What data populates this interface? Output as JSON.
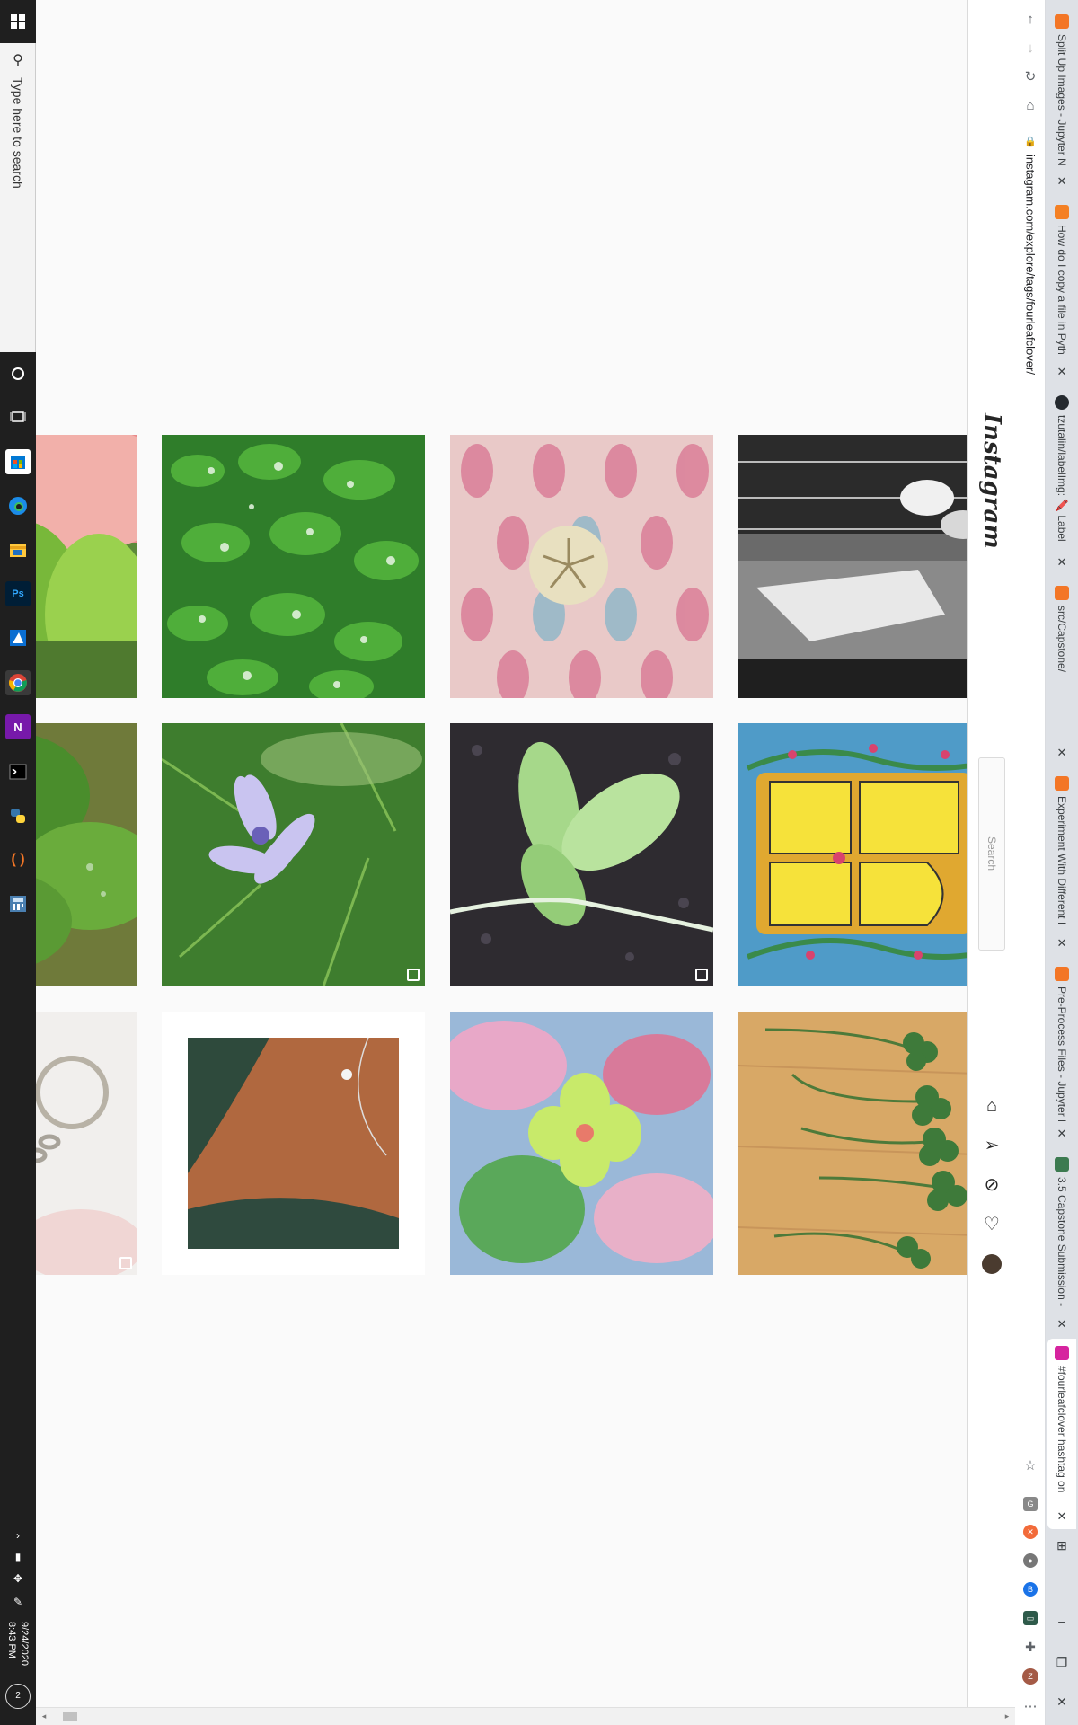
{
  "taskbar": {
    "search_placeholder": "Type here to search",
    "start_icon": "windows-logo-icon",
    "pinned_apps": [
      "cortana-circle-icon",
      "task-view-icon",
      "store-icon",
      "edge-icon",
      "file-explorer-icon",
      "photoshop-icon",
      "azure-data-studio-icon",
      "chrome-icon",
      "onenote-icon",
      "terminal-icon",
      "python-icon",
      "jupyter-icon",
      "calculator-icon"
    ],
    "tray_icons": [
      "chevron-up-icon",
      "battery-icon",
      "dropbox-icon",
      "pen-icon"
    ],
    "time": "8:43 PM",
    "date": "9/24/2020",
    "notifications_count": "2"
  },
  "browser": {
    "url": "instagram.com/explore/tags/fourleafclover/",
    "tabs": [
      {
        "title": "Split Up Images - Jupyter N",
        "favicon_color": "#f37626"
      },
      {
        "title": "How do I copy a file in Pyth",
        "favicon_color": "#f48024"
      },
      {
        "title": "tzutalin/labelImg: 🖍️ Label",
        "favicon_color": "#24292e"
      },
      {
        "title": "src/Capstone/",
        "favicon_color": "#f37626"
      },
      {
        "title": "Experiment With Different I",
        "favicon_color": "#f37626"
      },
      {
        "title": "Pre-Process Files - Jupyter N",
        "favicon_color": "#f37626"
      },
      {
        "title": "3.5 Capstone Submission -",
        "favicon_color": "#3c7a50"
      },
      {
        "title": "#fourleafclover hashtag on",
        "favicon_color": "#d6249f"
      }
    ],
    "active_tab_index": 7,
    "extension_icons": [
      "star-icon",
      "grammarly-icon",
      "x-extension-icon",
      "dark-circle-icon",
      "b-extension-icon",
      "screen-extension-icon",
      "puzzle-icon",
      "profile-z-icon"
    ],
    "profile_letter": "Z"
  },
  "instagram": {
    "logo_text": "Instagram",
    "search_placeholder": "Search",
    "nav_icons": [
      "home-icon",
      "direct-message-icon",
      "explore-icon",
      "heart-icon",
      "profile-avatar"
    ]
  },
  "posts": [
    {
      "subject": "clover-leaf-in-hand",
      "multi": false
    },
    {
      "subject": "wet-clover-patch",
      "multi": false
    },
    {
      "subject": "sand-dollar-on-pattern",
      "multi": false
    },
    {
      "subject": "black-white-flower-sketch",
      "multi": false
    },
    {
      "subject": "clover-closeup-green",
      "multi": false
    },
    {
      "subject": "chicory-flower",
      "multi": true
    },
    {
      "subject": "clover-sprout-soil",
      "multi": true
    },
    {
      "subject": "yellow-clover-drawing",
      "multi": false
    },
    {
      "subject": "clover-keychain",
      "multi": true
    },
    {
      "subject": "clover-necklace",
      "multi": false
    },
    {
      "subject": "painted-clover-watercolor",
      "multi": false
    },
    {
      "subject": "clovers-on-wood",
      "multi": false
    }
  ]
}
